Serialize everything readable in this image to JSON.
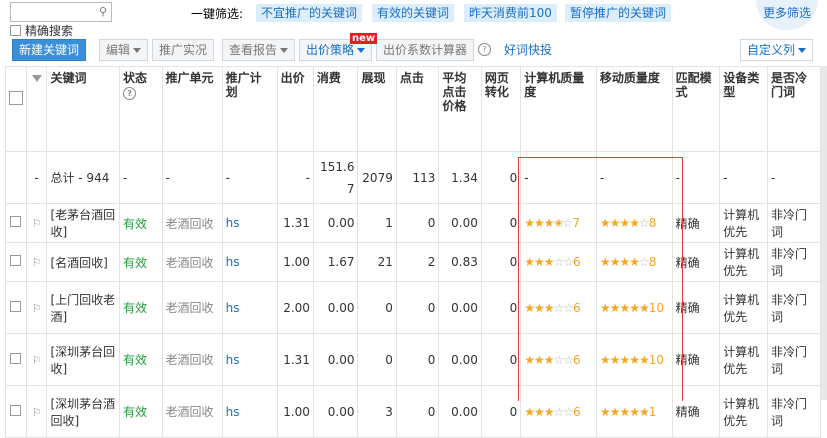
{
  "search": {
    "placeholder": "",
    "exact_label": "精确搜索"
  },
  "quick_filter": {
    "label": "一键筛选:",
    "items": [
      "不宜推广的关键词",
      "有效的关键词",
      "昨天消费前100",
      "暂停推广的关键词"
    ],
    "more": "更多筛选"
  },
  "toolbar": {
    "new_keyword": "新建关键词",
    "edit": "编辑",
    "promo": "推广实况",
    "report": "查看报告",
    "bid": "出价策略",
    "new_badge": "new",
    "bid_calc": "出价系数计算器",
    "quick": "好词快投",
    "custom": "自定义列"
  },
  "columns": [
    "关键词",
    "状态",
    "推广单元",
    "推广计划",
    "出价",
    "消费",
    "展现",
    "点击",
    "平均点击价格",
    "网页转化",
    "计算机质量度",
    "移动质量度",
    "匹配模式",
    "设备类型",
    "是否冷门词"
  ],
  "total": {
    "label": "总计 - 944",
    "dash": "-",
    "cost": "151.67",
    "impressions": "2079",
    "clicks": "113",
    "avg": "1.34",
    "conv": "0",
    "pc_q": "-",
    "m_q": "-",
    "match": "-",
    "device": "-",
    "cold": "-"
  },
  "rows": [
    {
      "kw": "[老茅台酒回收]",
      "status": "有效",
      "unit": "老酒回收",
      "plan": "hs",
      "bid": "1.31",
      "cost": "0.00",
      "imp": "1",
      "clk": "0",
      "avg": "0.00",
      "conv": "0",
      "pc_stars": 3.5,
      "pc_score": "7",
      "m_stars": 4,
      "m_score": "8",
      "match": "精确",
      "device": "计算机优先",
      "cold": "非冷门词"
    },
    {
      "kw": "[名酒回收]",
      "status": "有效",
      "unit": "老酒回收",
      "plan": "hs",
      "bid": "1.00",
      "cost": "1.67",
      "imp": "21",
      "clk": "2",
      "avg": "0.83",
      "conv": "0",
      "pc_stars": 3,
      "pc_score": "6",
      "m_stars": 4,
      "m_score": "8",
      "match": "精确",
      "device": "计算机优先",
      "cold": "非冷门词"
    },
    {
      "kw": "[上门回收老酒]",
      "status": "有效",
      "unit": "老酒回收",
      "plan": "hs",
      "bid": "2.00",
      "cost": "0.00",
      "imp": "0",
      "clk": "0",
      "avg": "0.00",
      "conv": "0",
      "pc_stars": 3,
      "pc_score": "6",
      "m_stars": 5,
      "m_score": "10",
      "match": "精确",
      "device": "计算机优先",
      "cold": "非冷门词"
    },
    {
      "kw": "[深圳茅台回收]",
      "status": "有效",
      "unit": "老酒回收",
      "plan": "hs",
      "bid": "1.31",
      "cost": "0.00",
      "imp": "0",
      "clk": "0",
      "avg": "0.00",
      "conv": "0",
      "pc_stars": 3,
      "pc_score": "6",
      "m_stars": 5,
      "m_score": "10",
      "match": "精确",
      "device": "计算机优先",
      "cold": "非冷门词"
    },
    {
      "kw": "[深圳茅台酒回收]",
      "status": "有效",
      "unit": "老酒回收",
      "plan": "hs",
      "bid": "1.00",
      "cost": "0.00",
      "imp": "3",
      "clk": "0",
      "avg": "0.00",
      "conv": "0",
      "pc_stars": 3,
      "pc_score": "6",
      "m_stars": 5,
      "m_score": "1",
      "match": "精确",
      "device": "计算机优先",
      "cold": "非冷门词"
    }
  ],
  "colors": {
    "accent": "#3b8fd9",
    "status_green": "#22a03c",
    "star": "#f5a623",
    "highlight_box": "#e03a3a"
  }
}
